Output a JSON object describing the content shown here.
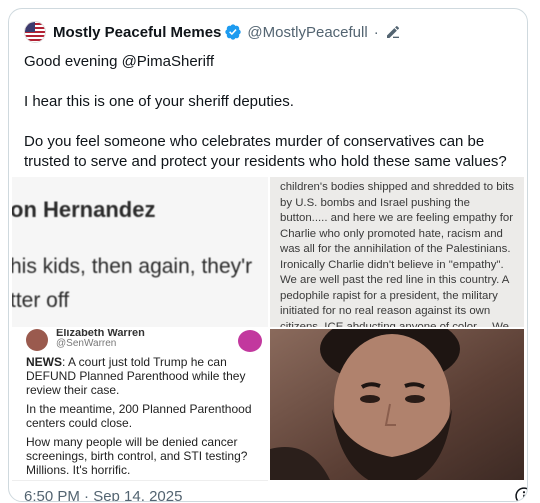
{
  "tweet": {
    "display_name": "Mostly Peaceful Memes",
    "handle": "@MostlyPeacefull",
    "separator": "·",
    "paragraphs": [
      "Good evening @PimaSheriff",
      "I hear this is one of your sheriff deputies.",
      "Do you feel someone who celebrates murder of conservatives can be trusted to serve and protect your residents who hold these same values?"
    ],
    "timestamp": "6:50 PM · Sep 14, 2025"
  },
  "media": {
    "image1": {
      "lines": [
        "on Hernandez",
        "his kids, then again, they'r",
        "tter off"
      ]
    },
    "image2": {
      "text": "children's bodies shipped and shredded to bits by U.S. bombs and Israel pushing the button..... and here we are feeling empathy for Charlie who only promoted hate, racism and was all for the annihilation of the Palestinians. Ironically Charlie didn't believe in \"empathy\". We are well past the red line in this country. A pedophile rapist for a president, the military initiated for no real reason against its own citizens, ICE abducting anyone of color.....We are long overdue for a revolution. As for poor Charlie , that's his own"
    },
    "image3": {
      "name": "Elizabeth Warren",
      "handle": "@SenWarren",
      "news_label": "NEWS",
      "news_text": ": A court just told Trump he can DEFUND Planned Parenthood while they review their case.",
      "para2": "In the meantime, 200 Planned Parenthood centers could close.",
      "para3": "How many people will be denied cancer screenings, birth control, and STI testing? Millions. It's horrific."
    }
  },
  "icons": {
    "verified": "verified-badge-icon",
    "edit": "edit-pencil-icon",
    "info": "info-icon",
    "avatar": "us-flag-avatar"
  },
  "colors": {
    "verified_blue": "#1d9bf0",
    "secondary_text": "#536471",
    "primary_text": "#0f1419"
  }
}
